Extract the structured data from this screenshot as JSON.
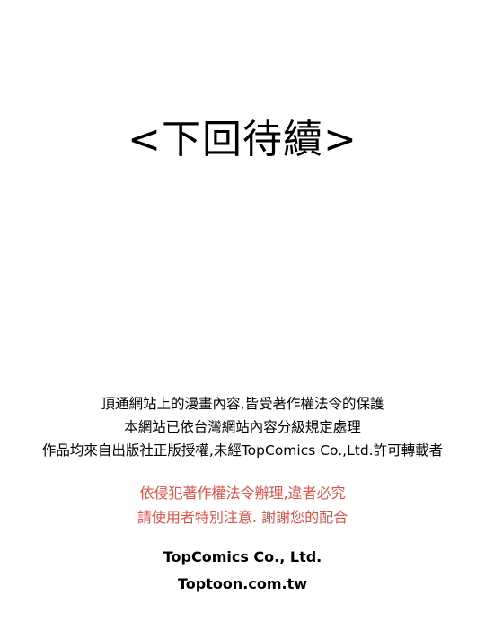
{
  "title": "<下回待續>",
  "notice": {
    "line1": "頂通網站上的漫畫內容,皆受著作權法令的保護",
    "line2": "本網站已依台灣網站內容分級規定處理",
    "line3": "作品均來自出版社正版授權,未經TopComics Co.,Ltd.許可轉載者"
  },
  "warning": {
    "line1": "依侵犯著作權法令辦理,違者必究",
    "line2": "請使用者特別注意. 謝謝您的配合"
  },
  "brand": {
    "company": "TopComics Co., Ltd.",
    "website": "Toptoon.com.tw"
  },
  "colors": {
    "warning_text": "#d9534b",
    "background": "#ffffff",
    "text": "#000000"
  }
}
